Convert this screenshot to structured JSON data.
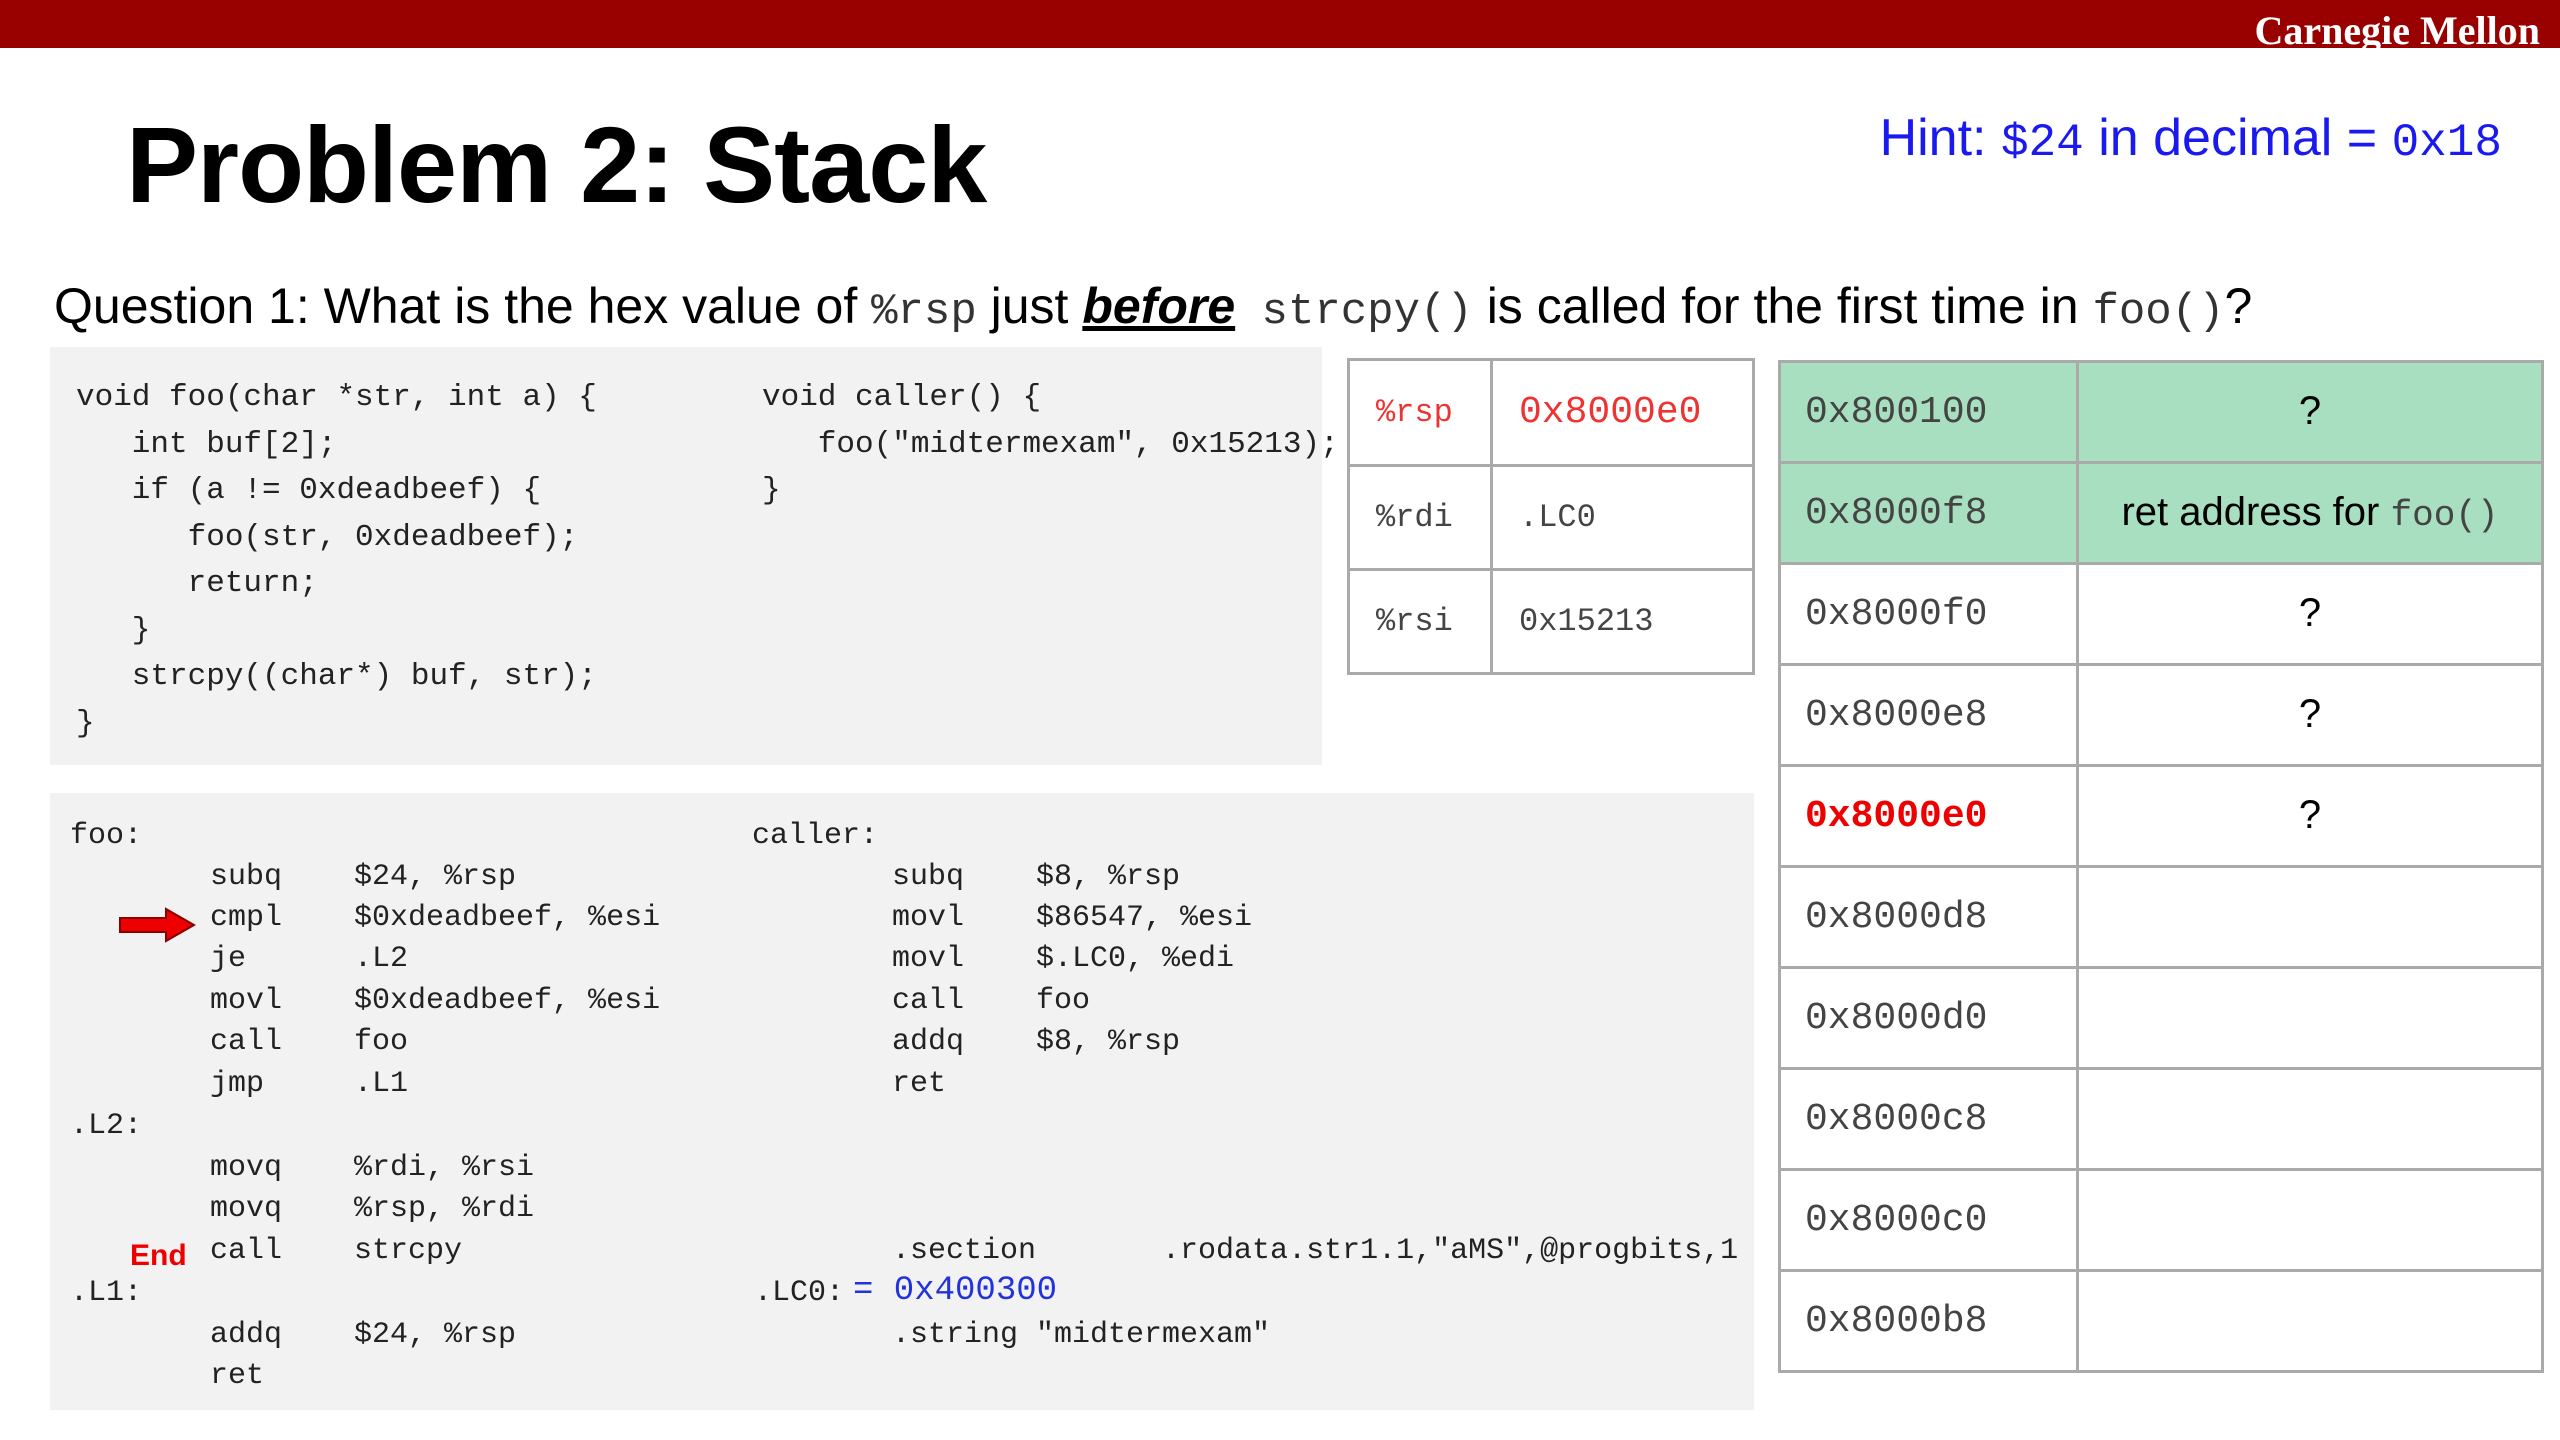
{
  "header": {
    "brand": "Carnegie Mellon",
    "bar_color": "#990000"
  },
  "slide": {
    "title": "Problem 2: Stack",
    "hint": {
      "prefix": "Hint: ",
      "value_code": "$24",
      "middle": " in decimal = ",
      "hex_code": "0x18"
    },
    "question": {
      "p1": "Question 1: What is the hex value of ",
      "reg": "%rsp",
      "p2": " just ",
      "emph": "before",
      "func1": " strcpy()",
      "p3": " is called for the first time in ",
      "func2": "foo()",
      "p4": "?"
    }
  },
  "c_code": {
    "foo": "void foo(char *str, int a) {\n   int buf[2];\n   if (a != 0xdeadbeef) {\n      foo(str, 0xdeadbeef);\n      return;\n   }\n   strcpy((char*) buf, str);\n}",
    "caller": "void caller() {\n   foo(\"midtermexam\", 0x15213);\n}"
  },
  "asm": {
    "foo_label": "foo:",
    "foo_lines": [
      "subq    $24, %rsp",
      "cmpl    $0xdeadbeef, %esi",
      "je      .L2",
      "movl    $0xdeadbeef, %esi",
      "call    foo",
      "jmp     .L1"
    ],
    "l2_label": ".L2:",
    "l2_lines": [
      "movq    %rdi, %rsi",
      "movq    %rsp, %rdi",
      "call    strcpy"
    ],
    "l1_label": ".L1:",
    "l1_lines": [
      "addq    $24, %rsp",
      "ret"
    ],
    "end_marker": "End",
    "caller_label": "caller:",
    "caller_lines": [
      "subq    $8, %rsp",
      "movl    $86547, %esi",
      "movl    $.LC0, %edi",
      "call    foo",
      "addq    $8, %rsp",
      "ret"
    ],
    "section_line": ".section       .rodata.str1.1,\"aMS\",@progbits,1",
    "lc0_label": ".LC0:",
    "lc0_value": "= 0x400300",
    "string_line": ".string \"midtermexam\"",
    "arrow_color": "#ee0000"
  },
  "registers": [
    {
      "name": "%rsp",
      "value": "0x8000e0"
    },
    {
      "name": "%rdi",
      "value": ".LC0"
    },
    {
      "name": "%rsi",
      "value": "0x15213"
    }
  ],
  "stack": [
    {
      "addr": "0x800100",
      "value": "?",
      "value_code": ""
    },
    {
      "addr": "0x8000f8",
      "value": "ret address for ",
      "value_code": "foo()"
    },
    {
      "addr": "0x8000f0",
      "value": "?",
      "value_code": ""
    },
    {
      "addr": "0x8000e8",
      "value": "?",
      "value_code": ""
    },
    {
      "addr": "0x8000e0",
      "value": "?",
      "value_code": ""
    },
    {
      "addr": "0x8000d8",
      "value": "",
      "value_code": ""
    },
    {
      "addr": "0x8000d0",
      "value": "",
      "value_code": ""
    },
    {
      "addr": "0x8000c8",
      "value": "",
      "value_code": ""
    },
    {
      "addr": "0x8000c0",
      "value": "",
      "value_code": ""
    },
    {
      "addr": "0x8000b8",
      "value": "",
      "value_code": ""
    }
  ],
  "colors": {
    "stack_highlight": "#a8dfc0",
    "hint_blue": "#1a1aee",
    "accent_red": "#ee0000"
  }
}
